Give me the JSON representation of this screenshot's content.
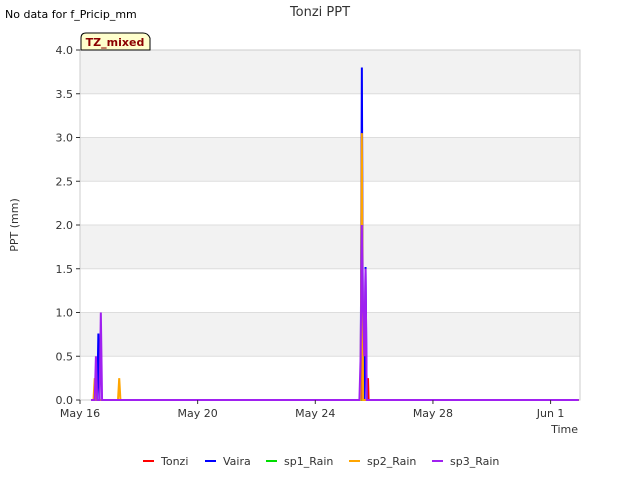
{
  "header": {
    "no_data_note": "No data for f_Pricip_mm"
  },
  "badge": {
    "label": "TZ_mixed"
  },
  "chart_data": {
    "type": "line",
    "title": "Tonzi PPT",
    "xlabel": "Time",
    "ylabel": "PPT (mm)",
    "ylim": [
      0,
      4.0
    ],
    "xlim": [
      "2024-05-16",
      "2024-06-02"
    ],
    "x_ticks": [
      {
        "label": "May 16",
        "date": "2024-05-16"
      },
      {
        "label": "May 20",
        "date": "2024-05-20"
      },
      {
        "label": "May 24",
        "date": "2024-05-24"
      },
      {
        "label": "May 28",
        "date": "2024-05-28"
      },
      {
        "label": "Jun 1",
        "date": "2024-06-01"
      }
    ],
    "y_ticks": [
      "0.0",
      "0.5",
      "1.0",
      "1.5",
      "2.0",
      "2.5",
      "3.0",
      "3.5",
      "4.0"
    ],
    "grid": true,
    "legend_position": "bottom",
    "series": [
      {
        "name": "Tonzi",
        "color": "#ff0000",
        "points": [
          [
            "2024-05-16T09:00",
            0
          ],
          [
            "2024-05-25T13:30",
            0
          ],
          [
            "2024-05-25T14:00",
            3.05
          ],
          [
            "2024-05-25T14:30",
            0
          ],
          [
            "2024-05-25T18:30",
            0
          ],
          [
            "2024-05-25T19:00",
            0.25
          ],
          [
            "2024-05-25T19:30",
            0
          ],
          [
            "2024-05-26T06:00",
            0
          ],
          [
            "2024-06-01T23:00",
            0
          ]
        ]
      },
      {
        "name": "Vaira",
        "color": "#0000ff",
        "points": [
          [
            "2024-05-16T09:00",
            0
          ],
          [
            "2024-05-16T14:00",
            0
          ],
          [
            "2024-05-16T15:00",
            0.76
          ],
          [
            "2024-05-16T16:00",
            0
          ],
          [
            "2024-05-25T13:00",
            0
          ],
          [
            "2024-05-25T14:00",
            3.8
          ],
          [
            "2024-05-25T15:00",
            0
          ],
          [
            "2024-05-25T16:00",
            0
          ],
          [
            "2024-05-25T17:00",
            1.52
          ],
          [
            "2024-05-25T18:00",
            0
          ],
          [
            "2024-06-01T23:00",
            0
          ]
        ]
      },
      {
        "name": "sp1_Rain",
        "color": "#00dd00",
        "points": [
          [
            "2024-05-16T09:00",
            0
          ],
          [
            "2024-06-01T23:00",
            0
          ]
        ]
      },
      {
        "name": "sp2_Rain",
        "color": "#ffa500",
        "points": [
          [
            "2024-05-16T09:00",
            0
          ],
          [
            "2024-05-16T11:00",
            0
          ],
          [
            "2024-05-16T12:00",
            0.25
          ],
          [
            "2024-05-16T13:00",
            0
          ],
          [
            "2024-05-17T07:00",
            0
          ],
          [
            "2024-05-17T08:00",
            0.25
          ],
          [
            "2024-05-17T09:00",
            0
          ],
          [
            "2024-05-25T13:00",
            0
          ],
          [
            "2024-05-25T14:00",
            3.05
          ],
          [
            "2024-05-25T15:00",
            0
          ],
          [
            "2024-06-01T23:00",
            0
          ]
        ]
      },
      {
        "name": "sp3_Rain",
        "color": "#a020f0",
        "points": [
          [
            "2024-05-16T09:00",
            0
          ],
          [
            "2024-05-16T12:00",
            0
          ],
          [
            "2024-05-16T13:00",
            0.5
          ],
          [
            "2024-05-16T14:00",
            0
          ],
          [
            "2024-05-16T16:00",
            0
          ],
          [
            "2024-05-16T17:00",
            1.0
          ],
          [
            "2024-05-16T18:00",
            0
          ],
          [
            "2024-05-25T12:00",
            0
          ],
          [
            "2024-05-25T13:00",
            0.5
          ],
          [
            "2024-05-25T14:00",
            2.0
          ],
          [
            "2024-05-25T15:00",
            1.0
          ],
          [
            "2024-05-25T16:00",
            0.5
          ],
          [
            "2024-05-25T17:00",
            1.5
          ],
          [
            "2024-05-25T18:00",
            0
          ],
          [
            "2024-06-01T23:00",
            0
          ]
        ]
      }
    ]
  }
}
